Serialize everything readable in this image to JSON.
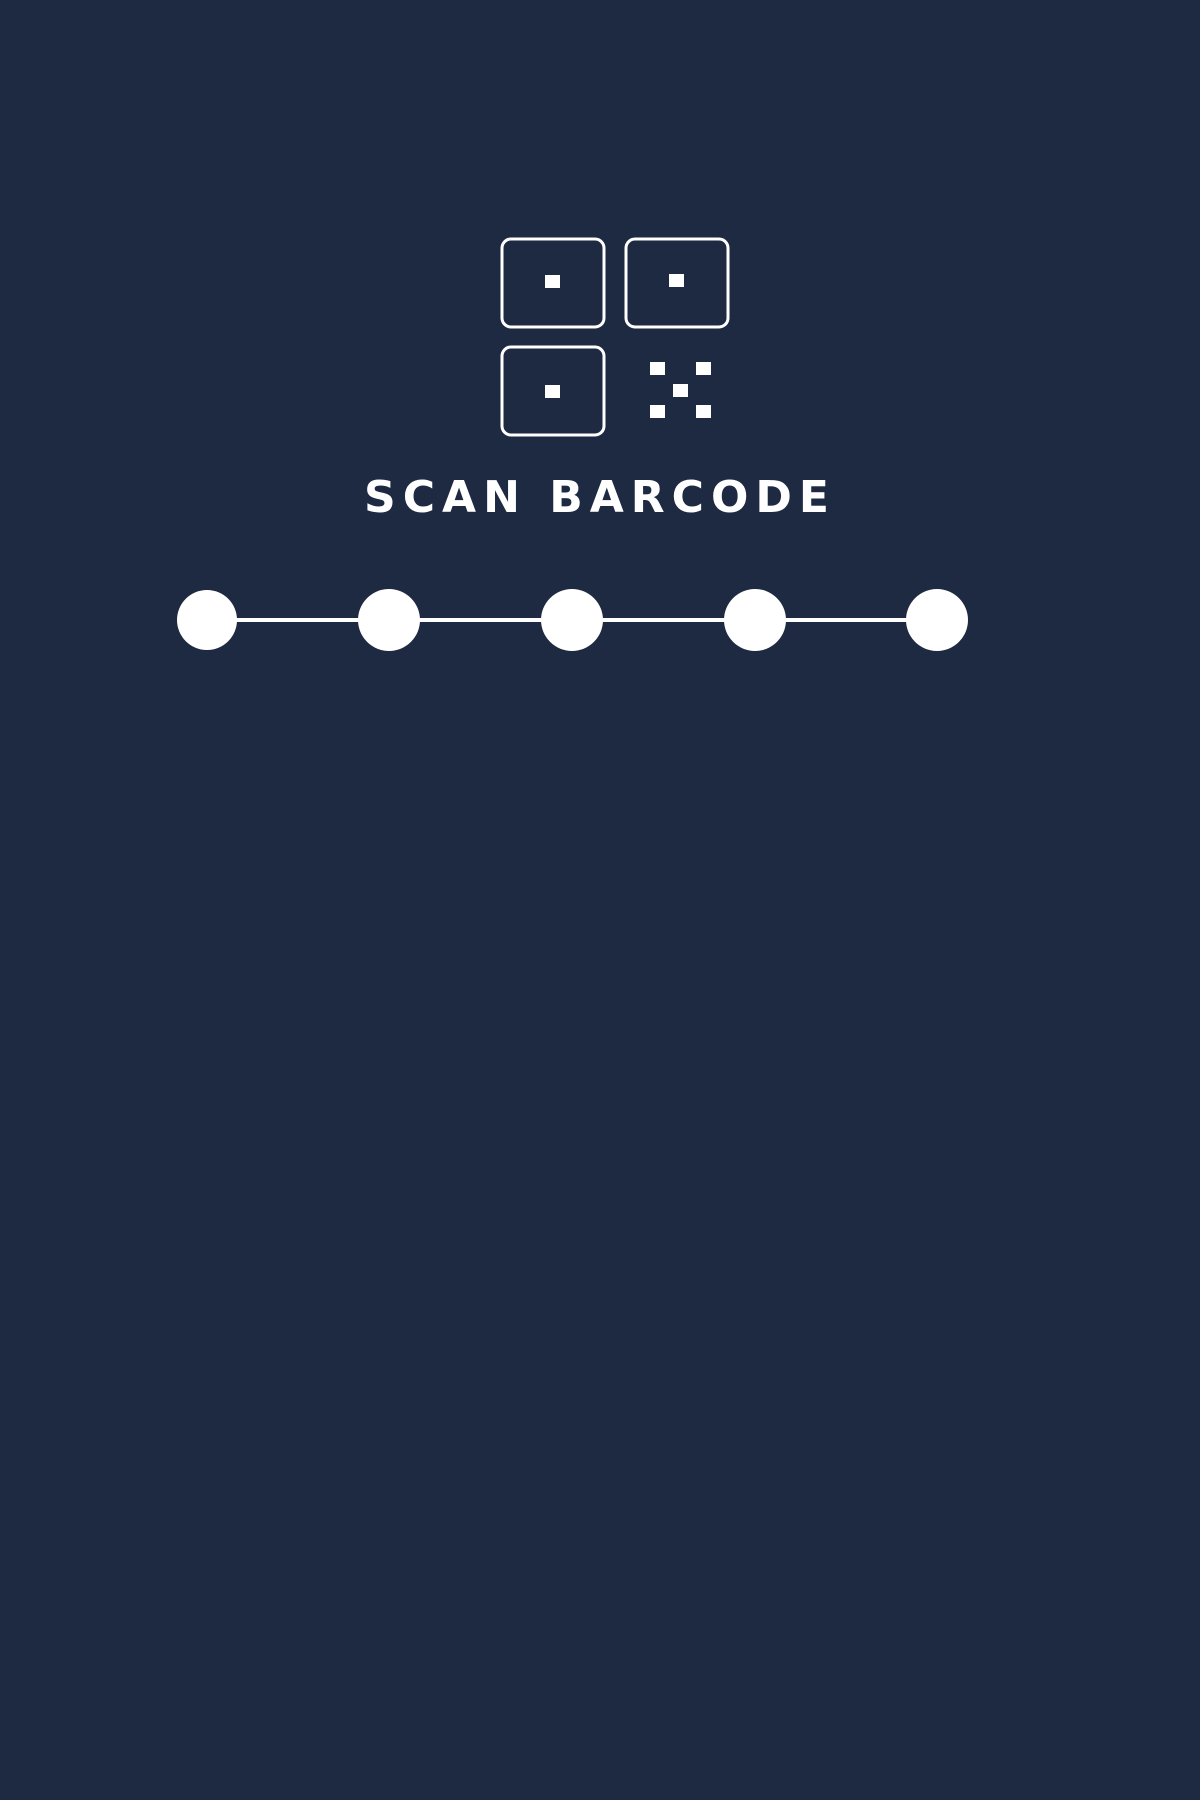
{
  "screen": {
    "title": "SCAN BARCODE",
    "icon": "qr-code-icon",
    "background_color": "#1e2a42",
    "foreground_color": "#ffffff"
  },
  "progress": {
    "total_steps": 5
  }
}
